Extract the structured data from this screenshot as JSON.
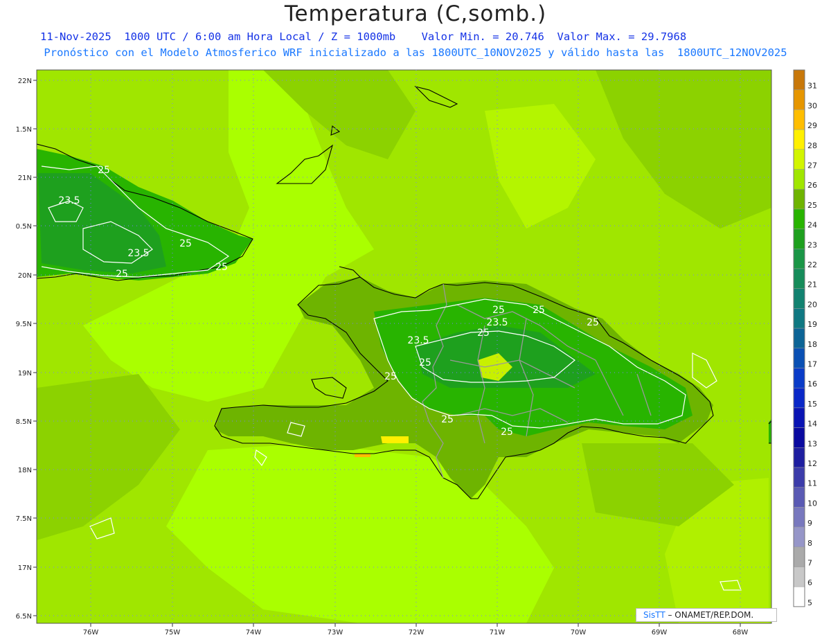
{
  "header": {
    "title": "Temperatura (C,somb.)",
    "line1": "11-Nov-2025  1000 UTC / 6:00 am Hora Local / Z = 1000mb    Valor Min. = 20.746  Valor Max. = 29.7968",
    "line2": "Pronóstico con el Modelo Atmosferico WRF inicializado a las 1800UTC_10NOV2025 y válido hasta las  1800UTC_12NOV2025"
  },
  "axes": {
    "lat_ticks": [
      "22N",
      "1.5N",
      "21N",
      "0.5N",
      "20N",
      "9.5N",
      "19N",
      "8.5N",
      "18N",
      "7.5N",
      "17N",
      "6.5N"
    ],
    "lon_ticks": [
      "76W",
      "75W",
      "74W",
      "73W",
      "72W",
      "71W",
      "70W",
      "69W",
      "68W"
    ]
  },
  "colorbar": {
    "labels": [
      "31",
      "30",
      "29",
      "28",
      "27",
      "26",
      "25",
      "24",
      "23",
      "22",
      "21",
      "20",
      "19",
      "18",
      "17",
      "16",
      "15",
      "14",
      "13",
      "12",
      "11",
      "10",
      "9",
      "8",
      "7",
      "6",
      "5"
    ],
    "colors": [
      "#c8780a",
      "#e69600",
      "#ffbe00",
      "#fff000",
      "#d2f500",
      "#a0e600",
      "#6eb400",
      "#28b400",
      "#1ea01e",
      "#1a9646",
      "#168c5a",
      "#128270",
      "#0f7882",
      "#0c6496",
      "#0a50b4",
      "#0a3cc8",
      "#0a28c8",
      "#0a14b4",
      "#0a0aa0",
      "#1e1ea0",
      "#3c3caa",
      "#5a5ab4",
      "#7878be",
      "#9696c8",
      "#aaaaaa",
      "#c8c8c8",
      "#ffffff"
    ]
  },
  "map": {
    "sea_color": "#aaff00",
    "contour_labels": [
      "25",
      "23.5",
      "25",
      "23.5",
      "25",
      "25",
      "25",
      "23.5",
      "25",
      "25",
      "25",
      "23.5",
      "25",
      "25",
      "25",
      "25"
    ]
  },
  "credit": {
    "sis": "SisTT",
    "org": " – ONAMET/REP.DOM."
  }
}
